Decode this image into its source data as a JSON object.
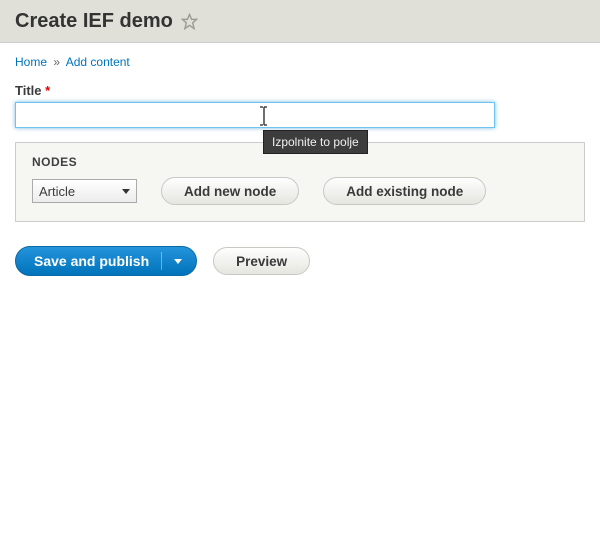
{
  "header": {
    "title": "Create IEF demo"
  },
  "breadcrumb": {
    "home": "Home",
    "sep": "»",
    "current": "Add content"
  },
  "form": {
    "title_label": "Title",
    "required_mark": "*",
    "title_value": "",
    "validation_tooltip": "Izpolnite to polje"
  },
  "nodes": {
    "legend": "NODES",
    "type_selected": "Article",
    "add_new_label": "Add new node",
    "add_existing_label": "Add existing node"
  },
  "actions": {
    "save_publish": "Save and publish",
    "preview": "Preview"
  }
}
